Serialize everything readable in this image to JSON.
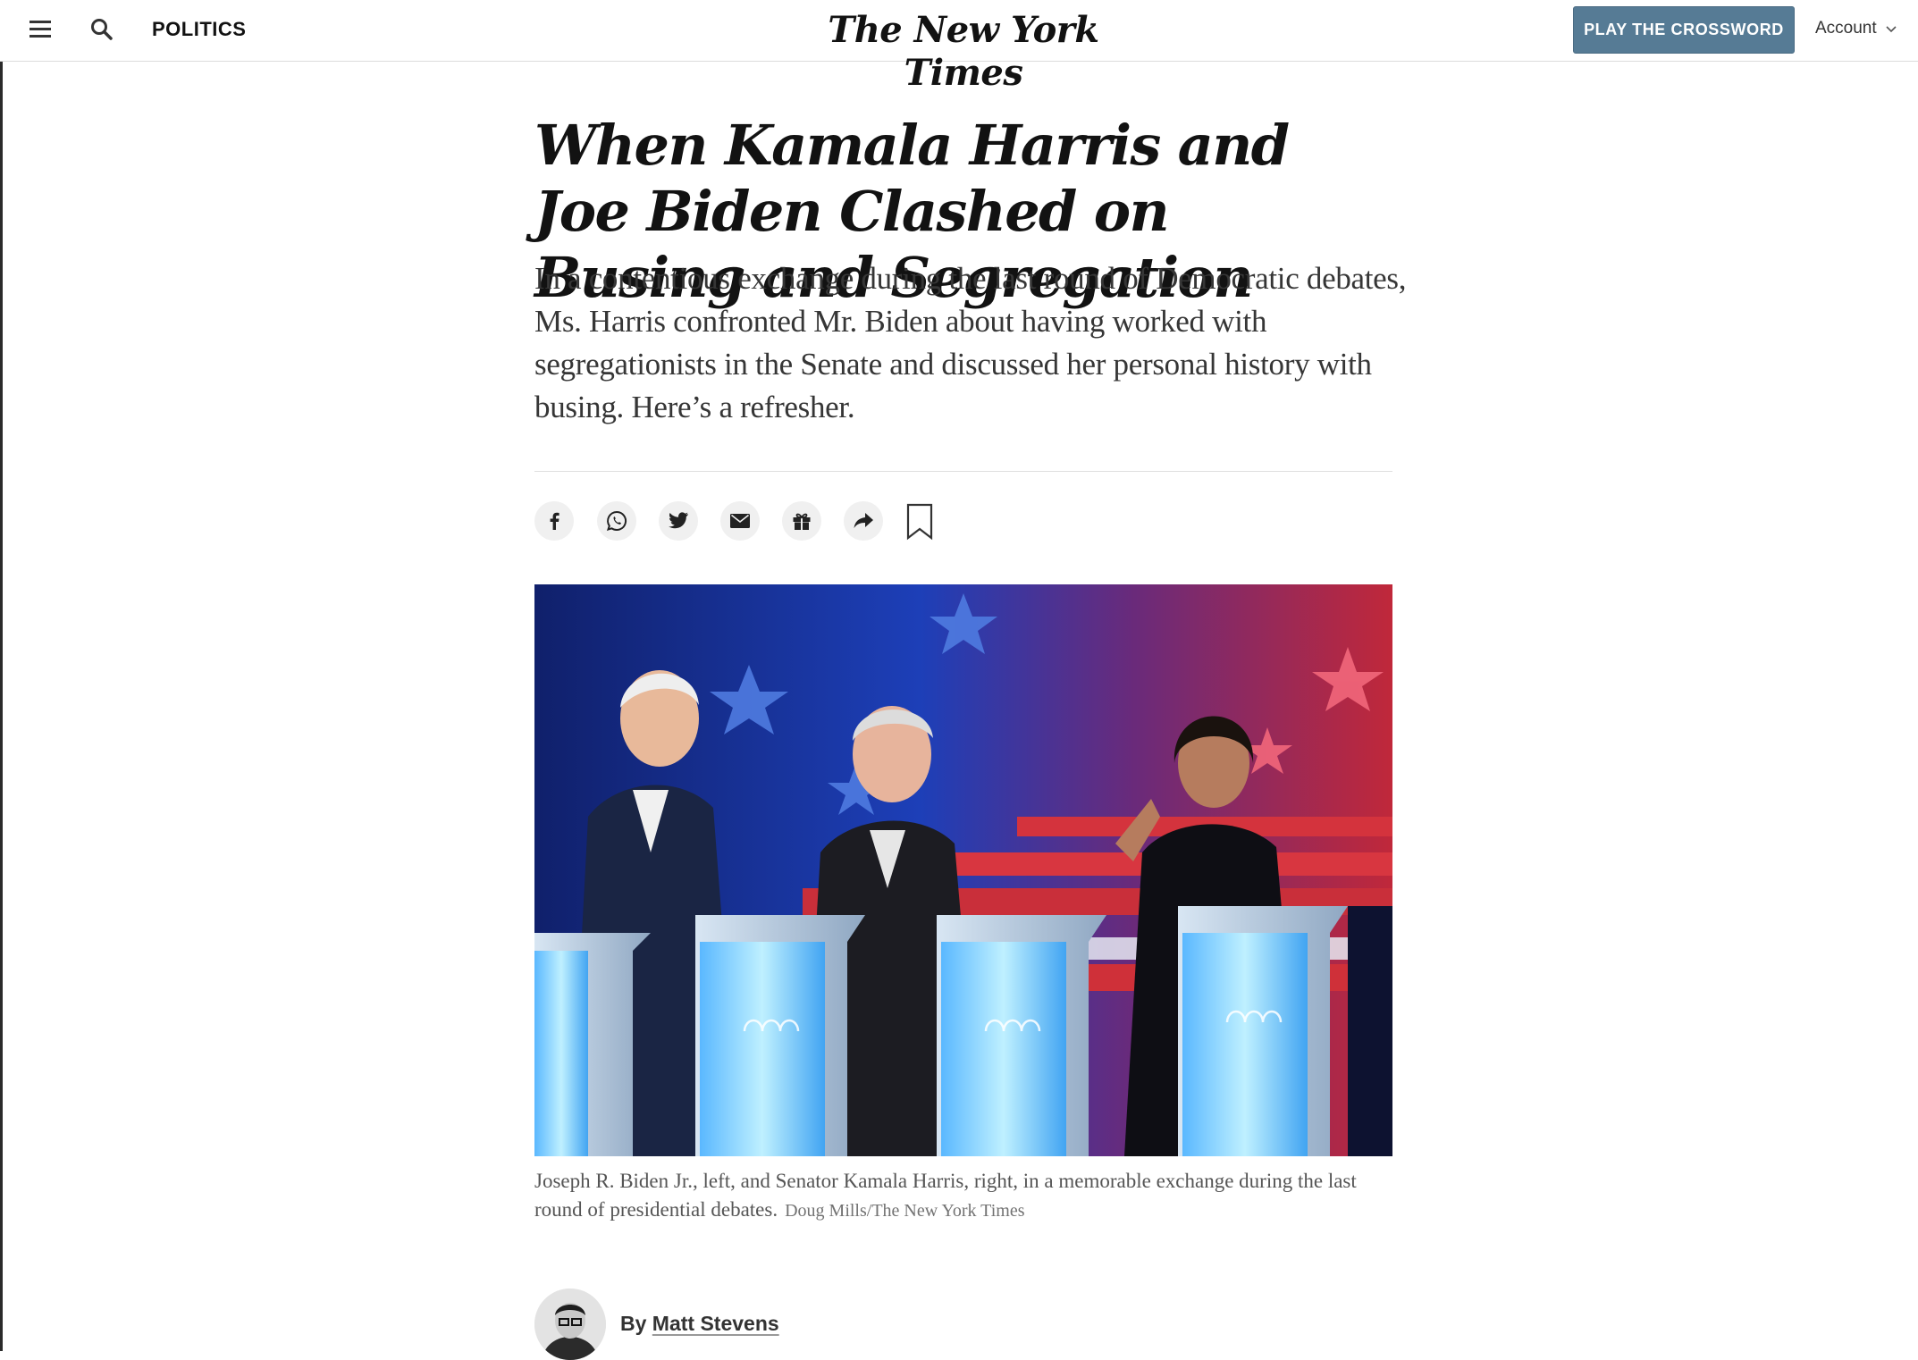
{
  "header": {
    "section": "POLITICS",
    "masthead": "The New York Times",
    "crossword_label": "PLAY THE CROSSWORD",
    "account_label": "Account",
    "accent_color": "#567b95"
  },
  "article": {
    "headline": "When Kamala Harris and Joe Biden Clashed on Busing and Segregation",
    "summary": "In a contentious exchange during the last round of Democratic debates, Ms. Harris confronted Mr. Biden about having worked with segregationists in the Senate and discussed her personal history with busing. Here’s a refresher.",
    "share_icons": [
      "facebook-icon",
      "whatsapp-icon",
      "twitter-icon",
      "email-icon",
      "gift-icon",
      "share-icon",
      "bookmark-icon"
    ],
    "photo": {
      "caption": "Joseph R. Biden Jr., left, and Senator Kamala Harris, right, in a memorable exchange during the last round of presidential debates.",
      "credit": "Doug Mills/The New York Times"
    },
    "byline": {
      "prefix": "By",
      "author": "Matt Stevens"
    }
  }
}
